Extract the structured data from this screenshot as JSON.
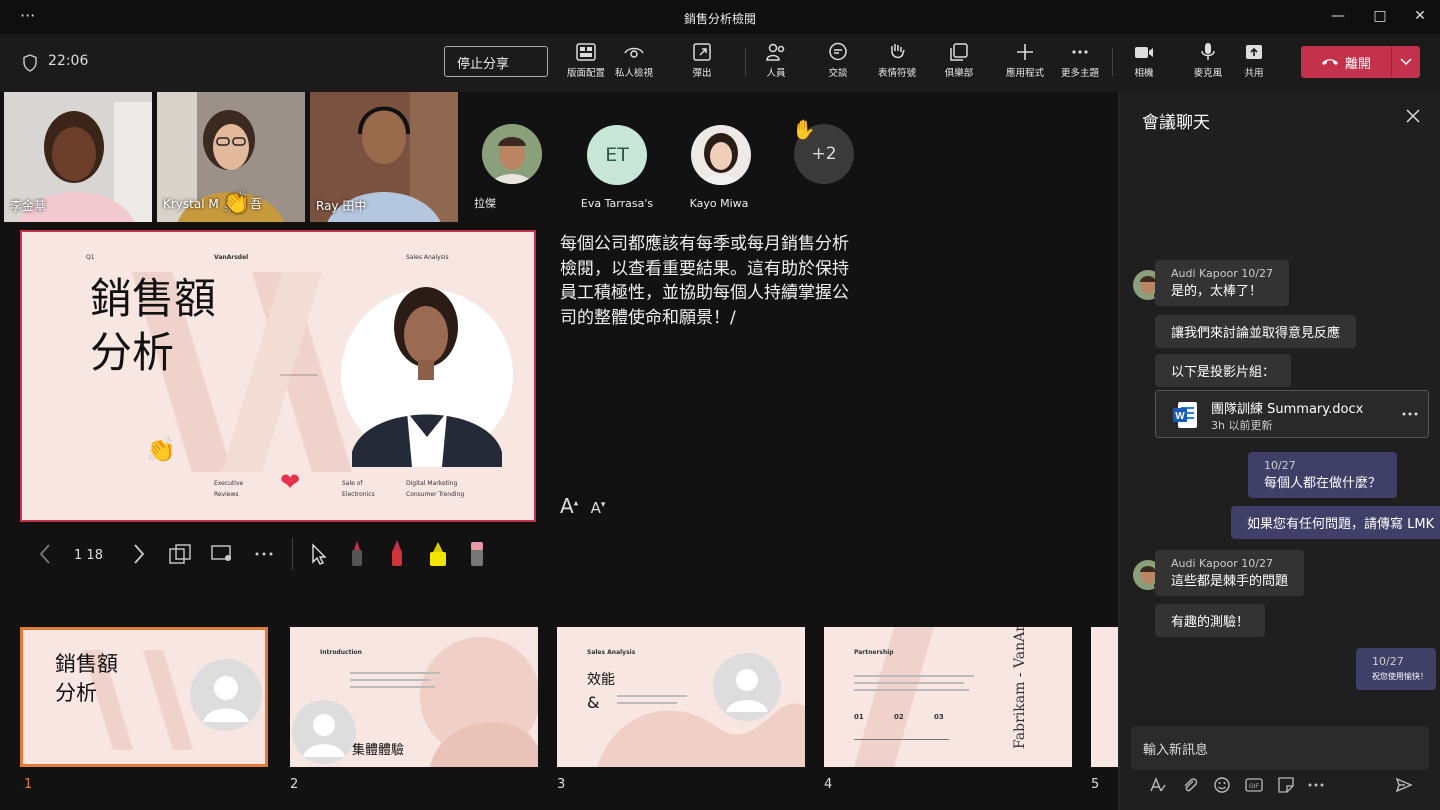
{
  "window": {
    "title": "銷售分析檢閱",
    "menu_dots": "···",
    "min": "—",
    "max": "□",
    "close": "✕"
  },
  "meeting": {
    "time": "22:06",
    "stop_share": "停止分享"
  },
  "toolbar": {
    "items": [
      {
        "icon": "layout-icon",
        "label": "版面配置"
      },
      {
        "icon": "eye-icon",
        "label": "私人檢視"
      },
      {
        "icon": "popout-icon",
        "label": "彈出"
      },
      {
        "icon": "people-icon",
        "label": "人員"
      },
      {
        "icon": "chat-icon",
        "label": "交談"
      },
      {
        "icon": "raise-hand-icon",
        "label": "表情符號"
      },
      {
        "icon": "rooms-icon",
        "label": "俱樂部"
      },
      {
        "icon": "apps-icon",
        "label": "應用程式"
      },
      {
        "icon": "more-icon",
        "label": "更多主題"
      },
      {
        "icon": "camera-icon",
        "label": "相機"
      },
      {
        "icon": "mic-icon",
        "label": "麥克風"
      },
      {
        "icon": "share-icon",
        "label": "共用"
      }
    ],
    "leave_label": "離開"
  },
  "participants": {
    "videos": [
      {
        "name": "李金華"
      },
      {
        "name": "Krystal M"
      },
      {
        "name": "Ray 田中"
      }
    ],
    "krystal_suffix": "吾",
    "avatars": [
      {
        "name": "拉傑"
      },
      {
        "name": "Eva Tarrasa's",
        "initials": "ET"
      },
      {
        "name": "Kayo Miwa"
      }
    ],
    "more": "+2"
  },
  "slide": {
    "q": "Q1",
    "brand": "VanArsdel",
    "section": "Sales Analysis",
    "title_line1": "銷售額",
    "title_line2": "分析",
    "foot1a": "Executive",
    "foot1b": "Reviews",
    "foot2a": "Sale of",
    "foot2b": "Electronics",
    "foot3a": "Digital Marketing",
    "foot3b": "Consumer Trending"
  },
  "notes": {
    "text": "每個公司都應該有每季或每月銷售分析檢閱，以查看重要結果。這有助於保持員工積極性，並協助每個人持續掌握公司的整體使命和願景！/"
  },
  "font_controls": {
    "increase": "A",
    "decrease": "A"
  },
  "slide_controls": {
    "current": "1",
    "total": "18"
  },
  "thumbnails": [
    {
      "num": "1",
      "title1": "銷售額",
      "title2": "分析"
    },
    {
      "num": "2",
      "heading": "Introduction",
      "caption": "集體體驗"
    },
    {
      "num": "3",
      "heading": "Sales Analysis",
      "caption1": "效能",
      "caption2": "&"
    },
    {
      "num": "4",
      "heading": "Partnership",
      "side": "Fabrikam - VanArsdel",
      "n1": "01",
      "n2": "02",
      "n3": "03"
    },
    {
      "num": "5"
    }
  ],
  "chat": {
    "title": "會議聊天",
    "messages": [
      {
        "author": "Audi Kapoor",
        "date": "10/27",
        "text": "是的，太棒了！"
      },
      {
        "text": "讓我們來討論並取得意見反應"
      },
      {
        "text": "以下是投影片組："
      },
      {
        "file_name": "團隊訓練 Summary.docx",
        "file_meta": "3h 以前更新"
      },
      {
        "date": "10/27",
        "text": "每個人都在做什麼？"
      },
      {
        "text": "如果您有任何問題，請傳寫 LMK"
      },
      {
        "author": "Audi Kapoor",
        "date": "10/27",
        "text": "這些都是棘手的問題"
      },
      {
        "text": "有趣的測驗！"
      },
      {
        "date": "10/27",
        "text": "祝您使用愉快！"
      }
    ],
    "compose_placeholder": "輸入新訊息"
  },
  "colors": {
    "accent": "#c4314b",
    "selected_thumb": "#e07b39",
    "my_bubble": "#3f3f68",
    "slide_bg": "#f7e6e2"
  }
}
